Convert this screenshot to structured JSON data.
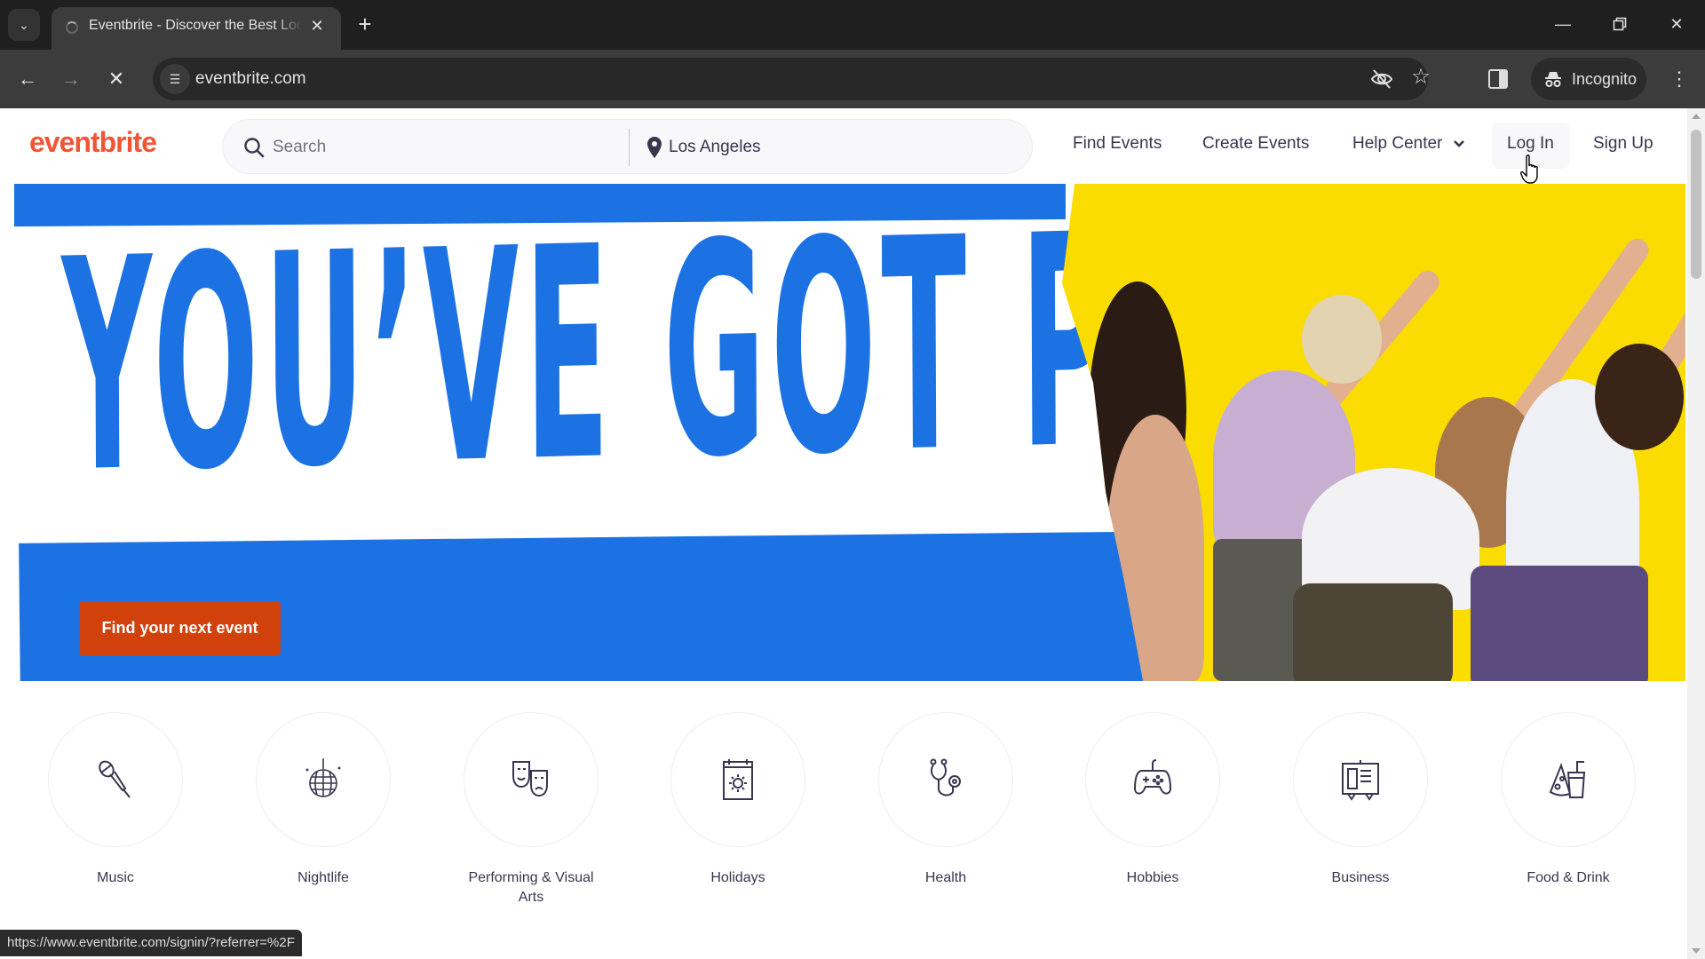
{
  "browser": {
    "tab_title": "Eventbrite - Discover the Best Local Events & Things to Do",
    "url": "eventbrite.com",
    "incognito_label": "Incognito",
    "status_url": "https://www.eventbrite.com/signin/?referrer=%2F",
    "loading": true
  },
  "header": {
    "logo": "eventbrite",
    "search_placeholder": "Search",
    "location_value": "Los Angeles",
    "nav": {
      "find_events": "Find Events",
      "create_events": "Create Events",
      "help_center": "Help Center",
      "log_in": "Log In",
      "sign_up": "Sign Up"
    }
  },
  "hero": {
    "headline": "YOU’VE GOT PLANS",
    "cta": "Find your next event",
    "colors": {
      "blue": "#1c72e3",
      "yellow": "#fadc00",
      "cta": "#d1410c"
    }
  },
  "categories": [
    {
      "label": "Music",
      "icon": "microphone-icon"
    },
    {
      "label": "Nightlife",
      "icon": "disco-ball-icon"
    },
    {
      "label": "Performing & Visual Arts",
      "icon": "theater-masks-icon"
    },
    {
      "label": "Holidays",
      "icon": "calendar-sun-icon"
    },
    {
      "label": "Health",
      "icon": "stethoscope-icon"
    },
    {
      "label": "Hobbies",
      "icon": "gamepad-icon"
    },
    {
      "label": "Business",
      "icon": "presentation-board-icon"
    },
    {
      "label": "Food & Drink",
      "icon": "pizza-drink-icon"
    }
  ],
  "brand_color": "#f05537"
}
